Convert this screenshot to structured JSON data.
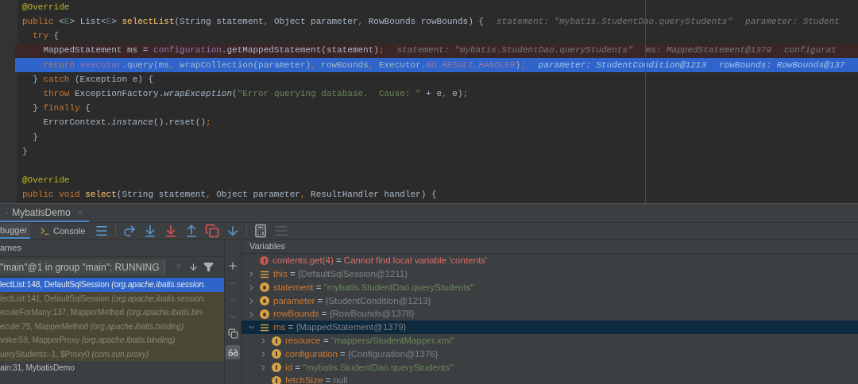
{
  "editor": {
    "lines": [
      {
        "kind": "plain",
        "tokens": [
          {
            "kind": "ann",
            "text": "@Override"
          }
        ]
      },
      {
        "kind": "plain",
        "tokens": [
          {
            "kind": "kw",
            "text": "public "
          },
          {
            "kind": "plain",
            "text": "<"
          },
          {
            "kind": "tp",
            "text": "E"
          },
          {
            "kind": "plain",
            "text": "> List<"
          },
          {
            "kind": "tp",
            "text": "E"
          },
          {
            "kind": "plain",
            "text": "> "
          },
          {
            "kind": "decl",
            "text": "selectList"
          },
          {
            "kind": "plain",
            "text": "(String statement"
          },
          {
            "kind": "kw",
            "text": ", "
          },
          {
            "kind": "plain",
            "text": "Object parameter"
          },
          {
            "kind": "kw",
            "text": ", "
          },
          {
            "kind": "plain",
            "text": "RowBounds rowBounds) {"
          }
        ],
        "hints": [
          "statement: \"mybatis.StudentDao.queryStudents\"",
          "parameter: Student"
        ]
      },
      {
        "kind": "plain",
        "tokens": [
          {
            "kind": "kw",
            "text": "  try "
          },
          {
            "kind": "plain",
            "text": "{"
          }
        ]
      },
      {
        "kind": "breakpoint",
        "tokens": [
          {
            "kind": "plain",
            "text": "    MappedStatement ms = "
          },
          {
            "kind": "field",
            "text": "configuration"
          },
          {
            "kind": "plain",
            "text": ".getMappedStatement(statement)"
          },
          {
            "kind": "kw",
            "text": ";"
          }
        ],
        "hints": [
          "statement: \"mybatis.StudentDao.queryStudents\"",
          "ms: MappedStatement@1379",
          "configurat"
        ]
      },
      {
        "kind": "current",
        "tokens": [
          {
            "kind": "kw",
            "text": "    return "
          },
          {
            "kind": "field",
            "text": "executor"
          },
          {
            "kind": "plain",
            "text": ".query(ms"
          },
          {
            "kind": "kw",
            "text": ", "
          },
          {
            "kind": "plain",
            "text": "wrapCollection(parameter)"
          },
          {
            "kind": "kw",
            "text": ", "
          },
          {
            "kind": "plain",
            "text": "rowBounds"
          },
          {
            "kind": "kw",
            "text": ", "
          },
          {
            "kind": "plain",
            "text": "Executor."
          },
          {
            "kind": "const",
            "text": "NO_RESULT_HANDLER"
          },
          {
            "kind": "plain",
            "text": ")"
          },
          {
            "kind": "kw",
            "text": ";"
          }
        ],
        "hints": [
          "parameter: StudentCondition@1213",
          "rowBounds: RowBounds@137"
        ]
      },
      {
        "kind": "plain",
        "tokens": [
          {
            "kind": "plain",
            "text": "  } "
          },
          {
            "kind": "kw",
            "text": "catch "
          },
          {
            "kind": "plain",
            "text": "(Exception e) {"
          }
        ]
      },
      {
        "kind": "plain",
        "tokens": [
          {
            "kind": "kw",
            "text": "    throw "
          },
          {
            "kind": "plain",
            "text": "ExceptionFactory."
          },
          {
            "kind": "italic",
            "text": "wrapException"
          },
          {
            "kind": "plain",
            "text": "("
          },
          {
            "kind": "str",
            "text": "\"Error querying database.  Cause: \""
          },
          {
            "kind": "plain",
            "text": " + e"
          },
          {
            "kind": "kw",
            "text": ", "
          },
          {
            "kind": "plain",
            "text": "e)"
          },
          {
            "kind": "kw",
            "text": ";"
          }
        ]
      },
      {
        "kind": "plain",
        "tokens": [
          {
            "kind": "plain",
            "text": "  } "
          },
          {
            "kind": "kw",
            "text": "finally "
          },
          {
            "kind": "plain",
            "text": "{"
          }
        ]
      },
      {
        "kind": "plain",
        "tokens": [
          {
            "kind": "plain",
            "text": "    ErrorContext."
          },
          {
            "kind": "italic",
            "text": "instance"
          },
          {
            "kind": "plain",
            "text": "().reset()"
          },
          {
            "kind": "kw",
            "text": ";"
          }
        ]
      },
      {
        "kind": "plain",
        "tokens": [
          {
            "kind": "plain",
            "text": "  }"
          }
        ]
      },
      {
        "kind": "plain",
        "tokens": [
          {
            "kind": "plain",
            "text": "}"
          }
        ]
      },
      {
        "kind": "blank"
      },
      {
        "kind": "plain",
        "tokens": [
          {
            "kind": "ann",
            "text": "@Override"
          }
        ]
      },
      {
        "kind": "plain",
        "tokens": [
          {
            "kind": "kw",
            "text": "public void "
          },
          {
            "kind": "decl",
            "text": "select"
          },
          {
            "kind": "plain",
            "text": "(String statement"
          },
          {
            "kind": "kw",
            "text": ", "
          },
          {
            "kind": "plain",
            "text": "Object parameter"
          },
          {
            "kind": "kw",
            "text": ", "
          },
          {
            "kind": "plain",
            "text": "ResultHandler handler) {"
          }
        ]
      }
    ]
  },
  "run_tab": {
    "label": "MybatisDemo",
    "close": "×"
  },
  "debug_tabs": [
    {
      "label": "bugger",
      "selected": true
    },
    {
      "label": "Console",
      "selected": false
    }
  ],
  "frames": {
    "title": "ames",
    "thread": "\"main\"@1 in group \"main\": RUNNING",
    "items": [
      {
        "method": "lectList:148, DefaultSqlSession",
        "package": "(org.apache.ibatis.session.",
        "selected": true,
        "kind": "library"
      },
      {
        "method": "lectList:141, DefaultSqlSession",
        "package": "(org.apache.ibatis.session.",
        "selected": false,
        "kind": "library"
      },
      {
        "method": "ecuteForMany:137, MapperMethod",
        "package": "(org.apache.ibatis.bin",
        "selected": false,
        "kind": "library"
      },
      {
        "method": "ecute:75, MapperMethod",
        "package": "(org.apache.ibatis.binding)",
        "selected": false,
        "kind": "library"
      },
      {
        "method": "voke:59, MapperProxy",
        "package": "(org.apache.ibatis.binding)",
        "selected": false,
        "kind": "library"
      },
      {
        "method": "ueryStudents:-1, $Proxy0",
        "package": "(com.sun.proxy)",
        "selected": false,
        "kind": "library"
      },
      {
        "method": "ain:31, MybatisDemo",
        "selected": false,
        "kind": "user"
      }
    ]
  },
  "variables": {
    "title": "Variables",
    "items": [
      {
        "kind": "error",
        "name": "contents.get(4)",
        "operator": "=",
        "value": "Cannot find local variable 'contents'",
        "selected": false
      },
      {
        "kind": "object",
        "expanded": false,
        "name": "this",
        "operator": "=",
        "value": "{DefaultSqlSession@1211}",
        "selected": false
      },
      {
        "kind": "param_string",
        "expanded": false,
        "name": "statement",
        "operator": "=",
        "value": "\"mybatis.StudentDao.queryStudents\"",
        "selected": false
      },
      {
        "kind": "param",
        "expanded": false,
        "name": "parameter",
        "operator": "=",
        "value": "{StudentCondition@1213}",
        "selected": false
      },
      {
        "kind": "param",
        "expanded": false,
        "name": "rowBounds",
        "operator": "=",
        "value": "{RowBounds@1378}",
        "selected": false
      },
      {
        "kind": "object",
        "expanded": true,
        "name": "ms",
        "operator": "=",
        "value": "{MappedStatement@1379}",
        "selected": true,
        "children": [
          {
            "kind": "field_string",
            "expanded": false,
            "name": "resource",
            "operator": "=",
            "value": "\"mappers/StudentMapper.xml\"",
            "selected": false
          },
          {
            "kind": "field",
            "expanded": false,
            "name": "configuration",
            "operator": "=",
            "value": "{Configuration@1376}",
            "selected": false
          },
          {
            "kind": "field_string",
            "expanded": false,
            "name": "id",
            "operator": "=",
            "value": "\"mybatis.StudentDao.queryStudents\"",
            "selected": false
          },
          {
            "kind": "field_null",
            "name": "fetchSize",
            "operator": "=",
            "value": "null",
            "selected": false
          }
        ]
      }
    ]
  }
}
